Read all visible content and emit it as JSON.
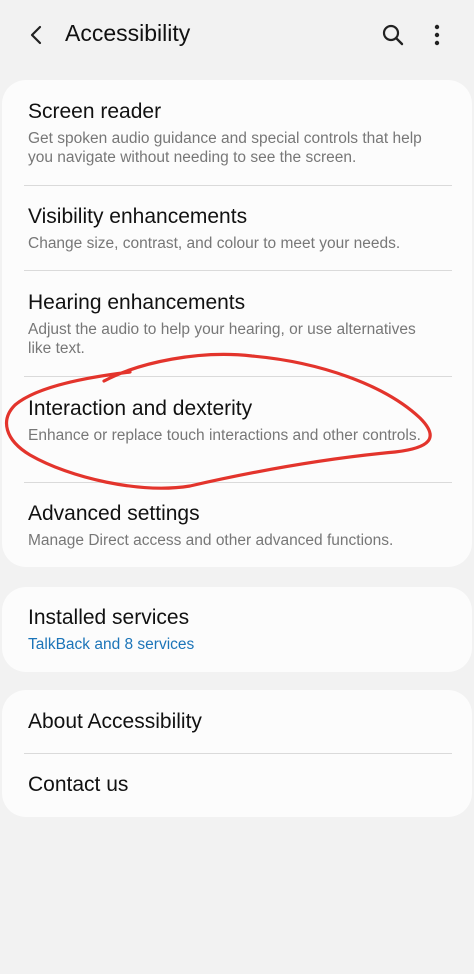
{
  "header": {
    "title": "Accessibility",
    "back_icon": "back-arrow-icon",
    "search_icon": "search-icon",
    "more_icon": "more-vertical-icon"
  },
  "main_group": {
    "items": [
      {
        "title": "Screen reader",
        "description": "Get spoken audio guidance and special controls that help you navigate without needing to see the screen."
      },
      {
        "title": "Visibility enhancements",
        "description": "Change size, contrast, and colour to meet your needs."
      },
      {
        "title": "Hearing enhancements",
        "description": "Adjust the audio to help your hearing, or use alternatives like text."
      },
      {
        "title": "Interaction and dexterity",
        "description": "Enhance or replace touch interactions and other controls."
      },
      {
        "title": "Advanced settings",
        "description": "Manage Direct access and other advanced functions."
      }
    ]
  },
  "installed_services": {
    "title": "Installed services",
    "subtitle": "TalkBack and 8 services"
  },
  "about_group": {
    "items": [
      {
        "title": "About Accessibility"
      },
      {
        "title": "Contact us"
      }
    ]
  },
  "colors": {
    "background": "#f2f2f2",
    "card": "#fcfcfc",
    "link_blue": "#1b74b8",
    "annotation_red": "#e3342c"
  }
}
